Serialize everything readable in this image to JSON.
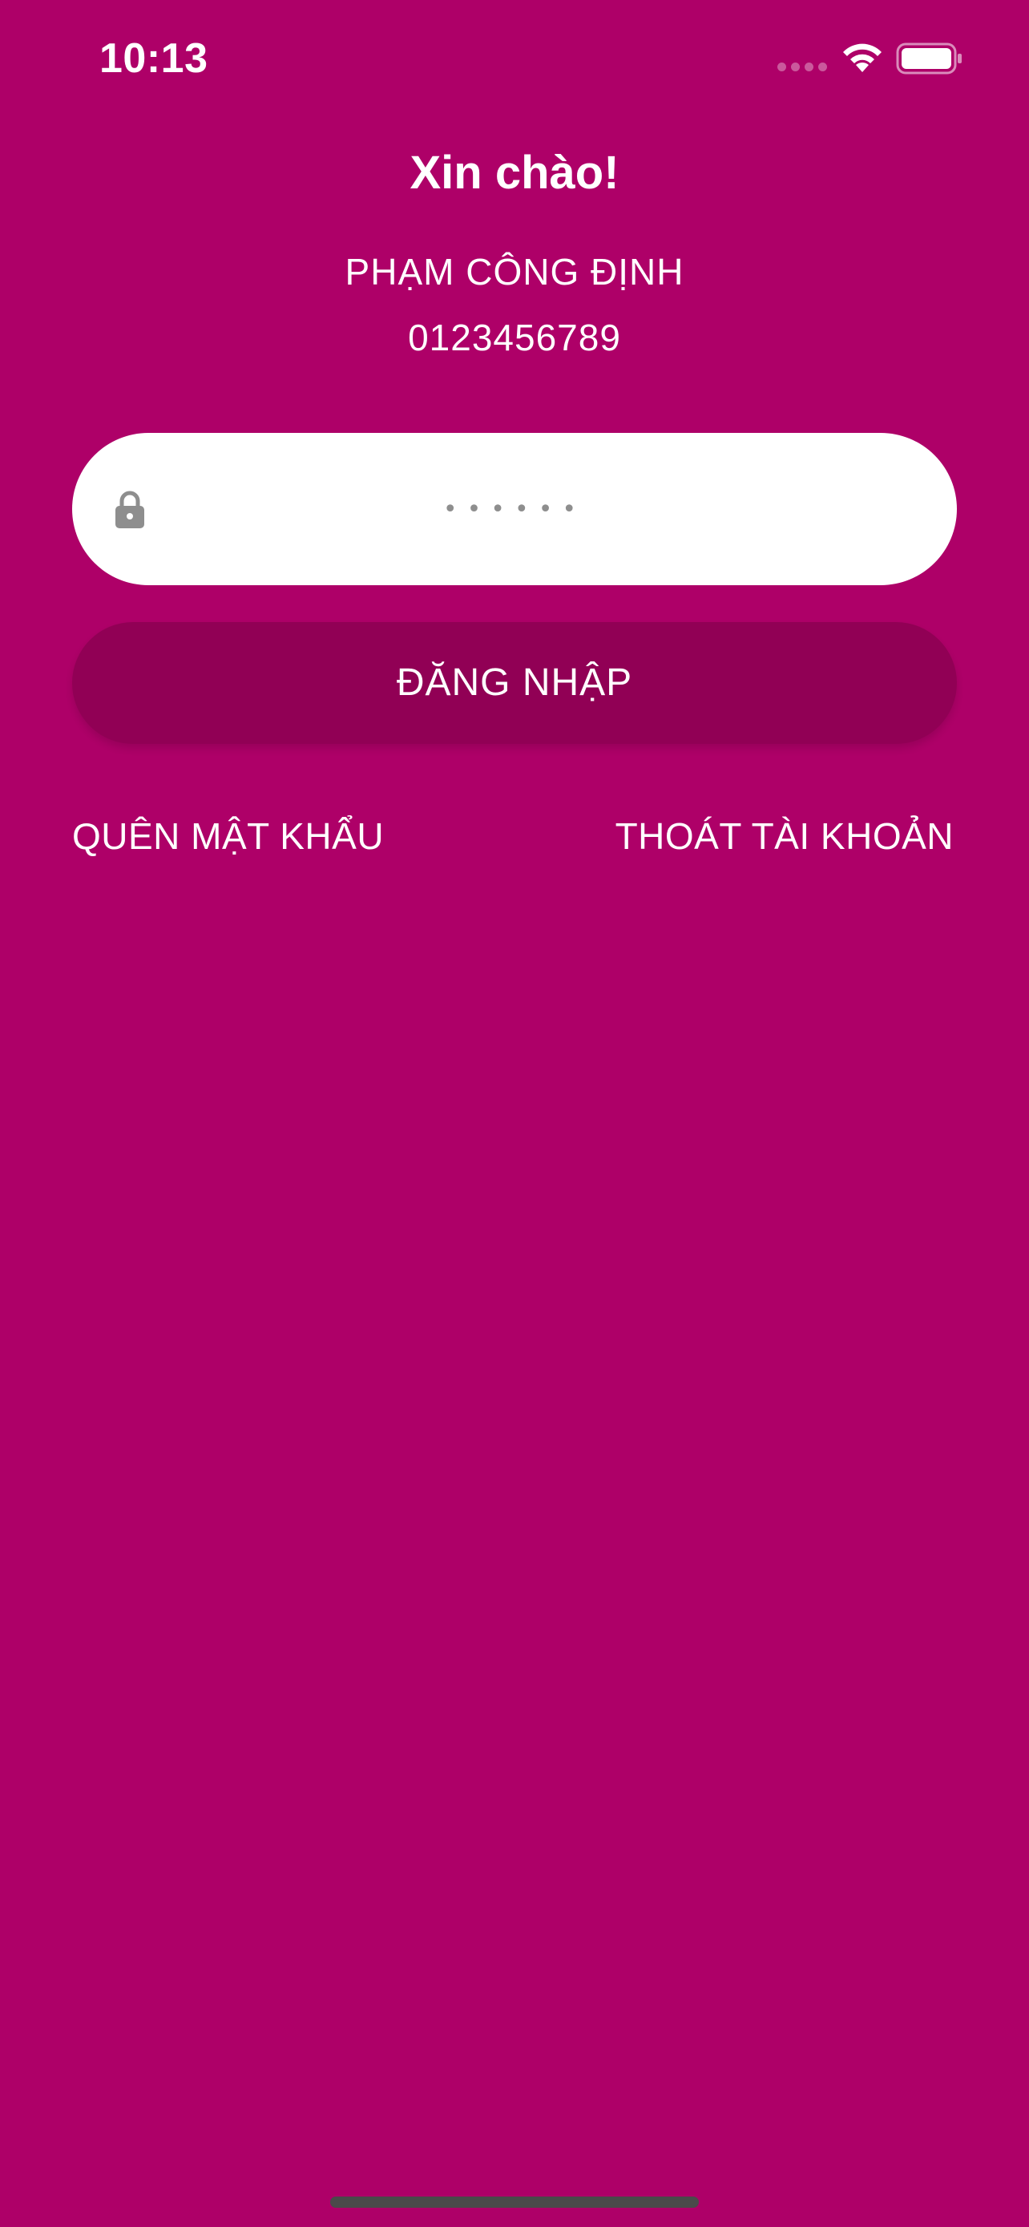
{
  "status_bar": {
    "time": "10:13",
    "icons": [
      "signal-icon",
      "wifi-icon",
      "battery-icon"
    ]
  },
  "greeting": "Xin chào!",
  "user": {
    "name": "PHẠM CÔNG ĐỊNH",
    "phone": "0123456789"
  },
  "password": {
    "value": "••••••",
    "icon": "lock-icon"
  },
  "login_button": "ĐĂNG NHẬP",
  "links": {
    "forgot_password": "QUÊN MẬT KHẨU",
    "logout": "THOÁT TÀI KHOẢN"
  },
  "colors": {
    "background": "#AE0068",
    "button": "#910055",
    "field": "#FFFFFF",
    "text": "#FFFFFF"
  }
}
